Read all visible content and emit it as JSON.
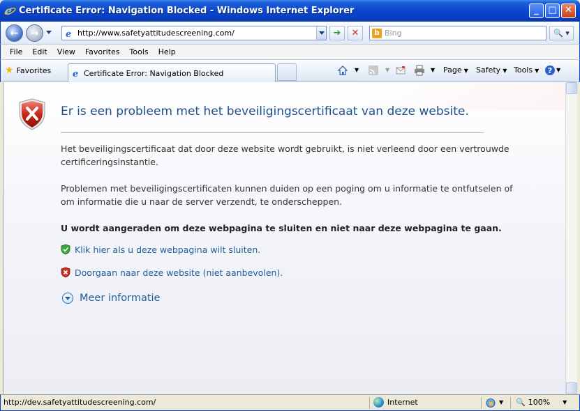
{
  "window": {
    "title": "Certificate Error: Navigation Blocked - Windows Internet Explorer",
    "minimize": "_",
    "maximize": "□",
    "close": "✕"
  },
  "address": {
    "url": "http://www.safetyattitudescreening.com/",
    "go_symbol": "➔",
    "stop_symbol": "✕"
  },
  "search": {
    "placeholder": "Bing",
    "engine_letter": "b",
    "button_symbol": "🔍 ▾"
  },
  "menu": {
    "items": [
      "File",
      "Edit",
      "View",
      "Favorites",
      "Tools",
      "Help"
    ]
  },
  "toolbar": {
    "favorites_label": "Favorites",
    "tab_title": "Certificate Error: Navigation Blocked",
    "page_label": "Page",
    "safety_label": "Safety",
    "tools_label": "Tools"
  },
  "content": {
    "heading": "Er is een probleem met het beveiligingscertificaat van deze website.",
    "paragraph1": "Het beveiligingscertificaat dat door deze website wordt gebruikt, is niet verleend door een vertrouwde certificeringsinstantie.",
    "paragraph2": "Problemen met beveiligingscertificaten kunnen duiden op een poging om u informatie te ontfutselen of om informatie die u naar de server verzendt, te onderscheppen.",
    "recommendation": "U wordt aangeraden om deze webpagina te sluiten en niet naar deze webpagina te gaan.",
    "close_link": "Klik hier als u deze webpagina wilt sluiten.",
    "continue_link": "Doorgaan naar deze website (niet aanbevolen).",
    "more_info": "Meer informatie"
  },
  "status": {
    "text": "http://dev.safetyattitudescreening.com/",
    "zone": "Internet",
    "zoom": "100%"
  },
  "colors": {
    "title_bar": "#0a46cf",
    "link": "#1f5f9a",
    "heading": "#1f4f8a"
  }
}
